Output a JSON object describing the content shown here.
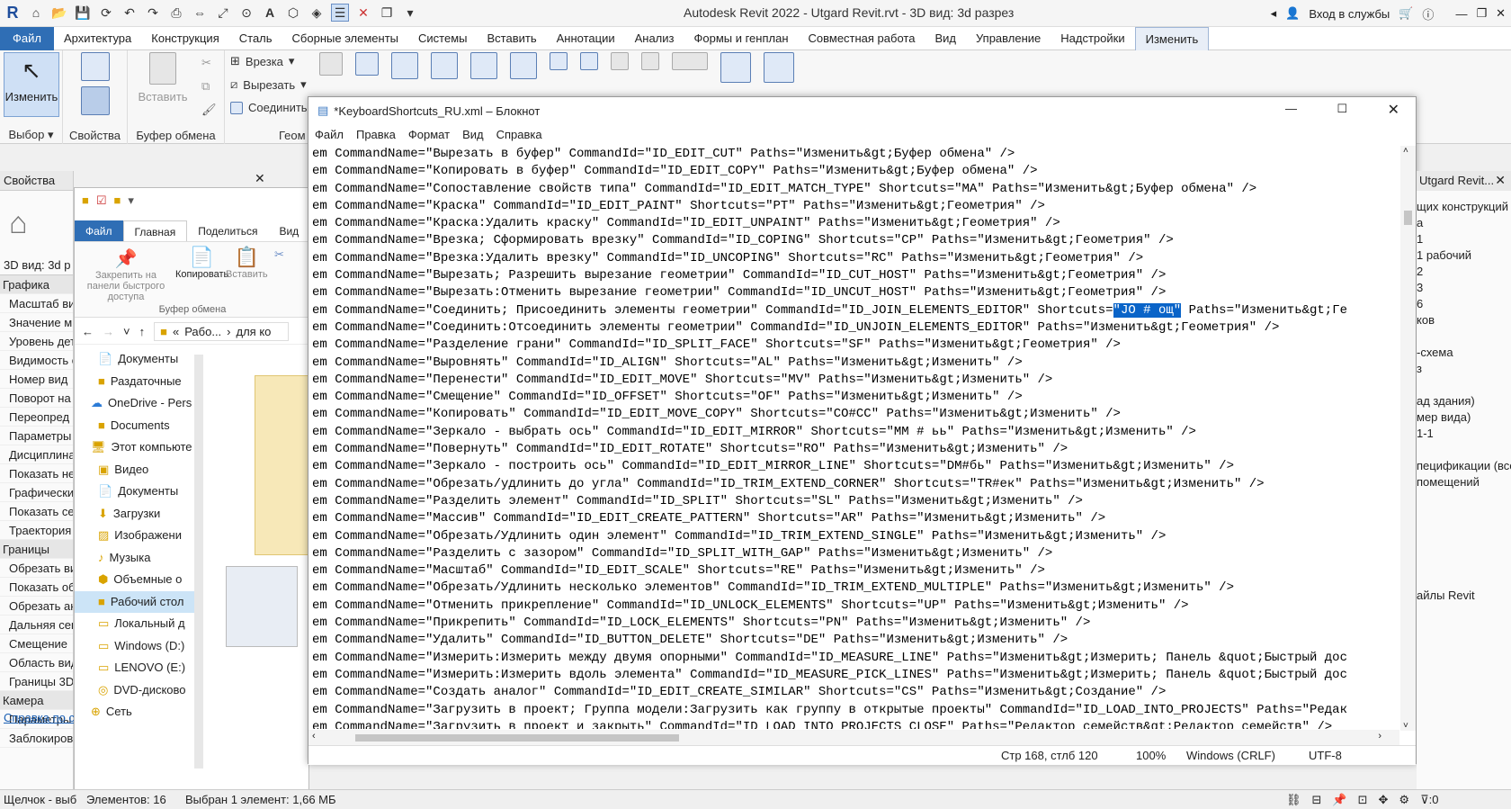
{
  "app": {
    "title": "Autodesk Revit 2022 - Utgard Revit.rvt - 3D вид: 3d разрез",
    "signin": "Вход в службы"
  },
  "menu": [
    "Файл",
    "Архитектура",
    "Конструкция",
    "Сталь",
    "Сборные элементы",
    "Системы",
    "Вставить",
    "Аннотации",
    "Анализ",
    "Формы и генплан",
    "Совместная работа",
    "Вид",
    "Управление",
    "Надстройки",
    "Изменить"
  ],
  "ribbon": {
    "modify_label": "Изменить",
    "select_label": "Выбор",
    "properties_label": "Свойства",
    "clipboard_label": "Буфер обмена",
    "paste_label": "Вставить",
    "geometry_label": "Геом",
    "cope": "Врезка",
    "cut": "Вырезать",
    "join": "Соединить"
  },
  "properties": {
    "title": "Свойства",
    "view": "3D вид: 3d р",
    "rows": [
      {
        "t": "Графика",
        "sec": true
      },
      {
        "t": "Масштаб ви"
      },
      {
        "t": "Значение м"
      },
      {
        "t": "Уровень дет"
      },
      {
        "t": "Видимость с"
      },
      {
        "t": "Номер вид"
      },
      {
        "t": "Поворот на"
      },
      {
        "t": "Переопред"
      },
      {
        "t": "Параметры"
      },
      {
        "t": "Дисциплина"
      },
      {
        "t": "Показать не"
      },
      {
        "t": "Графически"
      },
      {
        "t": "Показать се"
      },
      {
        "t": "Траектория"
      },
      {
        "t": "Границы",
        "sec": true
      },
      {
        "t": "Обрезать ви"
      },
      {
        "t": "Показать об"
      },
      {
        "t": "Обрезать ан"
      },
      {
        "t": "Дальняя сек"
      },
      {
        "t": "Смещение"
      },
      {
        "t": "Область вид"
      },
      {
        "t": "Границы 3D"
      },
      {
        "t": "Камера",
        "sec": true
      },
      {
        "t": "Параметры"
      },
      {
        "t": "Заблокиров"
      }
    ],
    "help": "Справка по с"
  },
  "explorer": {
    "tabs": [
      "Файл",
      "Главная",
      "Поделиться",
      "Вид"
    ],
    "pin": "Закрепить на панели быстрого доступа",
    "copy": "Копировать",
    "paste": "Вставить",
    "clipboard": "Буфер обмена",
    "path1": "Рабо...",
    "path2": "для ко",
    "tree": [
      "Документы",
      "Раздаточные",
      "OneDrive - Pers",
      "Documents",
      "Этот компьюте",
      "Видео",
      "Документы",
      "Загрузки",
      "Изображени",
      "Музыка",
      "Объемные о",
      "Рабочий стол",
      "Локальный д",
      "Windows (D:)",
      "LENOVO (E:)",
      "DVD-дисково",
      "Сеть"
    ],
    "count": "Элементов: 16",
    "selected": "Выбран 1 элемент: 1,66 МБ"
  },
  "notepad": {
    "title": "*KeyboardShortcuts_RU.xml – Блокнот",
    "menu": [
      "Файл",
      "Правка",
      "Формат",
      "Вид",
      "Справка"
    ],
    "lines": [
      "em CommandName=\"Вырезать в буфер\" CommandId=\"ID_EDIT_CUT\" Paths=\"Изменить&gt;Буфер обмена\" />",
      "em CommandName=\"Копировать в буфер\" CommandId=\"ID_EDIT_COPY\" Paths=\"Изменить&gt;Буфер обмена\" />",
      "em CommandName=\"Сопоставление свойств типа\" CommandId=\"ID_EDIT_MATCH_TYPE\" Shortcuts=\"MA\" Paths=\"Изменить&gt;Буфер обмена\" />",
      "em CommandName=\"Краска\" CommandId=\"ID_EDIT_PAINT\" Shortcuts=\"PT\" Paths=\"Изменить&gt;Геометрия\" />",
      "em CommandName=\"Краска:Удалить краску\" CommandId=\"ID_EDIT_UNPAINT\" Paths=\"Изменить&gt;Геометрия\" />",
      "em CommandName=\"Врезка; Сформировать врезку\" CommandId=\"ID_COPING\" Shortcuts=\"CP\" Paths=\"Изменить&gt;Геометрия\" />",
      "em CommandName=\"Врезка:Удалить врезку\" CommandId=\"ID_UNCOPING\" Shortcuts=\"RC\" Paths=\"Изменить&gt;Геометрия\" />",
      "em CommandName=\"Вырезать; Разрешить вырезание геометрии\" CommandId=\"ID_CUT_HOST\" Paths=\"Изменить&gt;Геометрия\" />",
      "em CommandName=\"Вырезать:Отменить вырезание геометрии\" CommandId=\"ID_UNCUT_HOST\" Paths=\"Изменить&gt;Геометрия\" />",
      "HL",
      "em CommandName=\"Соединить:Отсоединить элементы геометрии\" CommandId=\"ID_UNJOIN_ELEMENTS_EDITOR\" Paths=\"Изменить&gt;Геометрия\" />",
      "em CommandName=\"Разделение грани\" CommandId=\"ID_SPLIT_FACE\" Shortcuts=\"SF\" Paths=\"Изменить&gt;Геометрия\" />",
      "em CommandName=\"Выровнять\" CommandId=\"ID_ALIGN\" Shortcuts=\"AL\" Paths=\"Изменить&gt;Изменить\" />",
      "em CommandName=\"Перенести\" CommandId=\"ID_EDIT_MOVE\" Shortcuts=\"MV\" Paths=\"Изменить&gt;Изменить\" />",
      "em CommandName=\"Смещение\" CommandId=\"ID_OFFSET\" Shortcuts=\"OF\" Paths=\"Изменить&gt;Изменить\" />",
      "em CommandName=\"Копировать\" CommandId=\"ID_EDIT_MOVE_COPY\" Shortcuts=\"CO#CC\" Paths=\"Изменить&gt;Изменить\" />",
      "em CommandName=\"Зеркало - выбрать ось\" CommandId=\"ID_EDIT_MIRROR\" Shortcuts=\"MM # ьь\" Paths=\"Изменить&gt;Изменить\" />",
      "em CommandName=\"Повернуть\" CommandId=\"ID_EDIT_ROTATE\" Shortcuts=\"RO\" Paths=\"Изменить&gt;Изменить\" />",
      "em CommandName=\"Зеркало - построить ось\" CommandId=\"ID_EDIT_MIRROR_LINE\" Shortcuts=\"DM#бь\" Paths=\"Изменить&gt;Изменить\" />",
      "em CommandName=\"Обрезать/удлинить до угла\" CommandId=\"ID_TRIM_EXTEND_CORNER\" Shortcuts=\"TR#ек\" Paths=\"Изменить&gt;Изменить\" />",
      "em CommandName=\"Разделить элемент\" CommandId=\"ID_SPLIT\" Shortcuts=\"SL\" Paths=\"Изменить&gt;Изменить\" />",
      "em CommandName=\"Массив\" CommandId=\"ID_EDIT_CREATE_PATTERN\" Shortcuts=\"AR\" Paths=\"Изменить&gt;Изменить\" />",
      "em CommandName=\"Обрезать/Удлинить один элемент\" CommandId=\"ID_TRIM_EXTEND_SINGLE\" Paths=\"Изменить&gt;Изменить\" />",
      "em CommandName=\"Разделить с зазором\" CommandId=\"ID_SPLIT_WITH_GAP\" Paths=\"Изменить&gt;Изменить\" />",
      "em CommandName=\"Масштаб\" CommandId=\"ID_EDIT_SCALE\" Shortcuts=\"RE\" Paths=\"Изменить&gt;Изменить\" />",
      "em CommandName=\"Обрезать/Удлинить несколько элементов\" CommandId=\"ID_TRIM_EXTEND_MULTIPLE\" Paths=\"Изменить&gt;Изменить\" />",
      "em CommandName=\"Отменить прикрепление\" CommandId=\"ID_UNLOCK_ELEMENTS\" Shortcuts=\"UP\" Paths=\"Изменить&gt;Изменить\" />",
      "em CommandName=\"Прикрепить\" CommandId=\"ID_LOCK_ELEMENTS\" Shortcuts=\"PN\" Paths=\"Изменить&gt;Изменить\" />",
      "em CommandName=\"Удалить\" CommandId=\"ID_BUTTON_DELETE\" Shortcuts=\"DE\" Paths=\"Изменить&gt;Изменить\" />",
      "em CommandName=\"Измерить:Измерить между двумя опорными\" CommandId=\"ID_MEASURE_LINE\" Paths=\"Изменить&gt;Измерить; Панель &quot;Быстрый дос",
      "em CommandName=\"Измерить:Измерить вдоль элемента\" CommandId=\"ID_MEASURE_PICK_LINES\" Paths=\"Изменить&gt;Измерить; Панель &quot;Быстрый дос",
      "em CommandName=\"Создать аналог\" CommandId=\"ID_EDIT_CREATE_SIMILAR\" Shortcuts=\"CS\" Paths=\"Изменить&gt;Создание\" />",
      "em CommandName=\"Загрузить в проект; Группа модели:Загрузить как группу в открытые проекты\" CommandId=\"ID_LOAD_INTO_PROJECTS\" Paths=\"Редак",
      "em CommandName=\"Загрузить в проект и закрыть\" CommandId=\"ID_LOAD_INTO_PROJECTS_CLOSE\" Paths=\"Редактор семейств&gt;Редактор семейств\" />"
    ],
    "hl_before": "em CommandName=\"Соединить; Присоединить элементы геометрии\" CommandId=\"ID_JOIN_ELEMENTS_EDITOR\" Shortcuts=",
    "hl_sel": "\"JO # ощ\"",
    "hl_after": " Paths=\"Изменить&gt;Ге",
    "status": {
      "pos": "Стр 168, стлб 120",
      "zoom": "100%",
      "eol": "Windows (CRLF)",
      "enc": "UTF-8"
    }
  },
  "rightpanel": {
    "title": "Utgard Revit...",
    "items": [
      "щих конструкций",
      "а",
      "1",
      "1 рабочий",
      "2",
      "3",
      "6",
      "ков",
      "",
      "-схема",
      "з",
      "",
      "ад здания)",
      "мер вида)",
      "1-1",
      "",
      "пецификации (все",
      "помещений",
      "",
      "",
      "",
      "",
      "",
      "",
      "айлы Revit"
    ]
  },
  "statusbar": {
    "left": "Щелчок - выб",
    "count": "Элементов: 16",
    "selected": "Выбран 1 элемент: 1,66 МБ",
    "filter": ":0"
  }
}
